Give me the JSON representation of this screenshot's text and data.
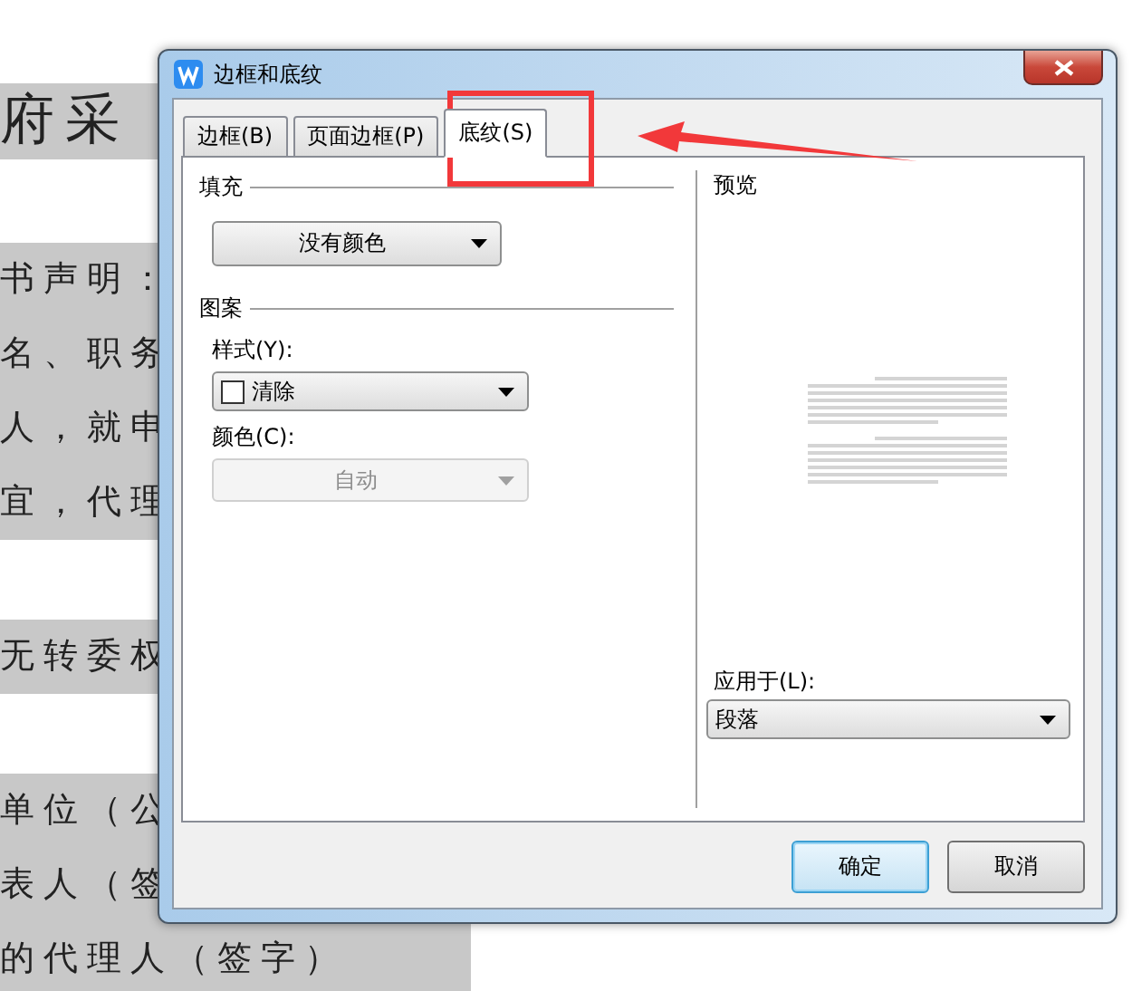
{
  "document": {
    "paragraphs": [
      {
        "kind": "heading",
        "lines": [
          "府采"
        ]
      },
      {
        "kind": "body",
        "lines": [
          "书声明：",
          "名、职务",
          "人，就申",
          "宜，代理"
        ]
      },
      {
        "kind": "body",
        "lines": [
          "无转委权"
        ]
      },
      {
        "kind": "body",
        "lines": [
          "单位（公",
          "表人（签",
          "的代理人（签字）"
        ]
      }
    ]
  },
  "dialog": {
    "title": "边框和底纹",
    "tabs": [
      {
        "label": "边框(B)",
        "selected": false
      },
      {
        "label": "页面边框(P)",
        "selected": false
      },
      {
        "label": "底纹(S)",
        "selected": true
      }
    ],
    "fill": {
      "heading": "填充",
      "color_select": "没有颜色"
    },
    "pattern": {
      "heading": "图案",
      "style_label": "样式(Y):",
      "style_value": "清除",
      "color_label": "颜色(C):",
      "color_value": "自动",
      "color_disabled": true
    },
    "preview": {
      "heading": "预览",
      "apply_label": "应用于(L):",
      "apply_value": "段落"
    },
    "buttons": [
      {
        "label": "确定",
        "default": true
      },
      {
        "label": "取消",
        "default": false
      }
    ]
  }
}
